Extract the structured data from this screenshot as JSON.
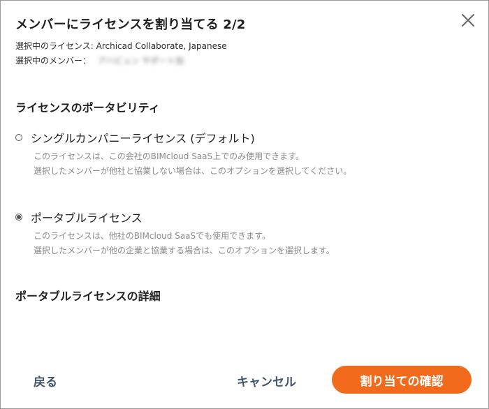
{
  "dialog": {
    "title": "メンバーにライセンスを割り当てる 2/2",
    "selected_license_label": "選択中のライセンス:",
    "selected_license_value": "Archicad Collaborate, Japanese",
    "selected_member_label": "選択中のメンバー：",
    "selected_member_value": "アハビュン サポート加"
  },
  "portability": {
    "heading": "ライセンスのポータビリティ",
    "options": [
      {
        "label": "シングルカンパニーライセンス (デフォルト)",
        "checked": false,
        "desc_line1": "このライセンスは、この会社のBIMcloud SaaS上でのみ使用できます。",
        "desc_line2": "選択したメンバーが他社と協業しない場合は、このオプションを選択してください。"
      },
      {
        "label": "ポータブルライセンス",
        "checked": true,
        "desc_line1": "このライセンスは、他社のBIMcloud SaaSでも使用できます。",
        "desc_line2": "選択したメンバーが他の企業と協業する場合は、このオプションを選択します。"
      }
    ]
  },
  "details": {
    "heading": "ポータブルライセンスの詳細"
  },
  "footer": {
    "back_label": "戻る",
    "cancel_label": "キャンセル",
    "confirm_label": "割り当ての確認"
  },
  "colors": {
    "accent": "#f26b1d",
    "link": "#44556b"
  },
  "icons": {
    "close": "close-icon"
  }
}
